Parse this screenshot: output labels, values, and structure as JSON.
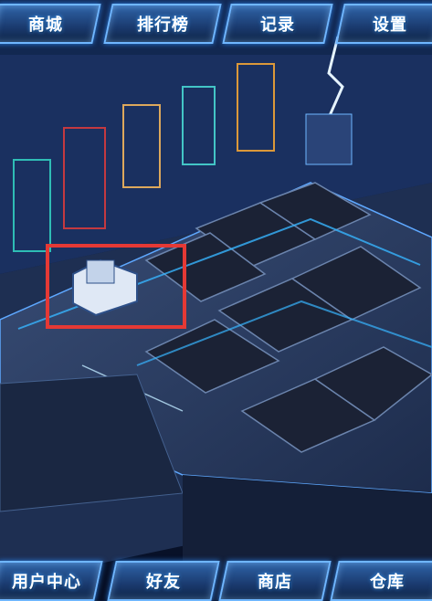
{
  "top_nav": {
    "shop": "商城",
    "ranking": "排行榜",
    "records": "记录",
    "settings": "设置"
  },
  "bottom_nav": {
    "user_center": "用户中心",
    "friends": "好友",
    "store": "商店",
    "warehouse": "仓库"
  },
  "colors": {
    "highlight": "#e53935",
    "button_border": "#6fb6ff",
    "background": "#0a1733"
  }
}
